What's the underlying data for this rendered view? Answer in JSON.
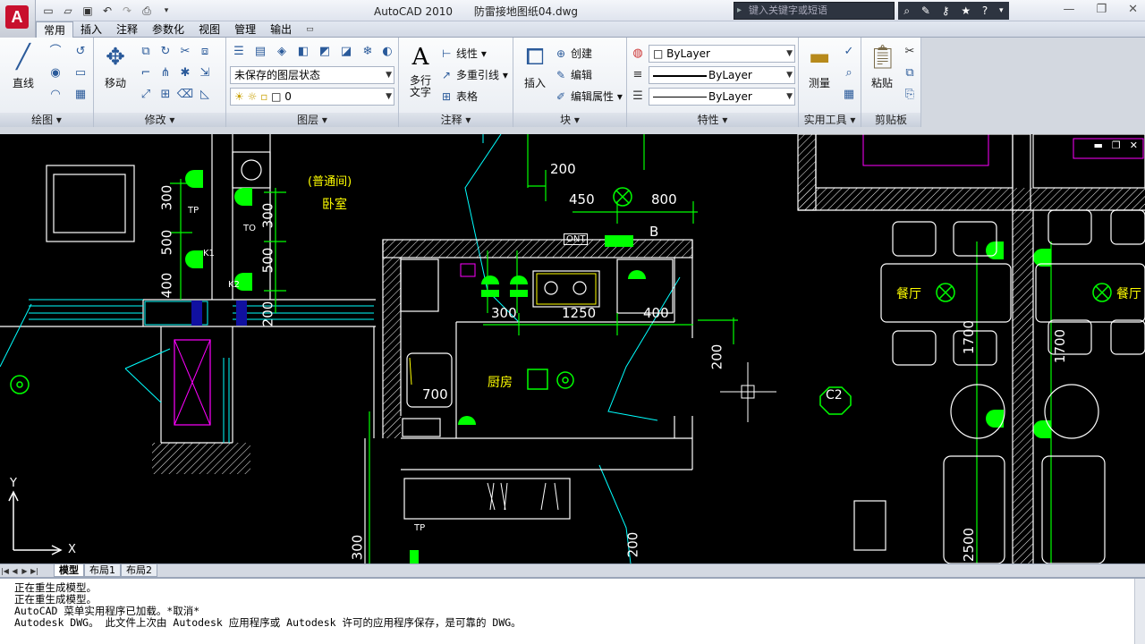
{
  "titlebar": {
    "app_name": "AutoCAD 2010",
    "doc_name": "防雷接地图纸04.dwg",
    "search_placeholder": "键入关键字或短语"
  },
  "tabs": [
    "常用",
    "插入",
    "注释",
    "参数化",
    "视图",
    "管理",
    "输出"
  ],
  "active_tab": "常用",
  "ribbon": {
    "draw": {
      "title": "绘图",
      "line_label": "直线"
    },
    "modify": {
      "title": "修改",
      "move_label": "移动"
    },
    "layers": {
      "title": "图层",
      "layer_state": "未保存的图层状态",
      "current_layer": "0"
    },
    "annotation": {
      "title": "注释",
      "mtext_label": "多行文字",
      "linetype": "线性",
      "mleader": "多重引线",
      "table": "表格"
    },
    "block": {
      "title": "块",
      "insert_label": "插入",
      "create": "创建",
      "edit": "编辑",
      "edit_attr": "编辑属性"
    },
    "properties": {
      "title": "特性",
      "color": "ByLayer",
      "linetype": "ByLayer",
      "lineweight": "ByLayer"
    },
    "utilities": {
      "title": "实用工具",
      "measure_label": "测量"
    },
    "clipboard": {
      "title": "剪贴板",
      "paste_label": "粘贴"
    }
  },
  "drawing": {
    "room_labels": [
      "(普通间)",
      "卧室",
      "厨房",
      "餐厅",
      "餐厅"
    ],
    "dims": [
      "200",
      "450",
      "800",
      "300",
      "1250",
      "400",
      "300",
      "500",
      "400",
      "300",
      "500",
      "200",
      "700",
      "200",
      "1700",
      "1700",
      "200",
      "300",
      "2500"
    ],
    "tags": [
      "TP",
      "TO",
      "K1",
      "K2",
      "ONT",
      "B",
      "C2",
      "TP"
    ],
    "ucs_x": "X",
    "ucs_y": "Y"
  },
  "layout_tabs": [
    "模型",
    "布局1",
    "布局2"
  ],
  "active_layout": "模型",
  "command_lines": [
    "正在重生成模型。",
    "正在重生成模型。",
    "AutoCAD 菜单实用程序已加载。*取消*",
    "Autodesk DWG。  此文件上次由 Autodesk 应用程序或 Autodesk 许可的应用程序保存，是可靠的 DWG。"
  ],
  "colors": {
    "canvas_bg": "#000000",
    "cad_white": "#ffffff",
    "cad_green": "#00ff00",
    "cad_cyan": "#00ffff",
    "cad_magenta": "#ff00ff",
    "cad_yellow": "#ffff00"
  }
}
